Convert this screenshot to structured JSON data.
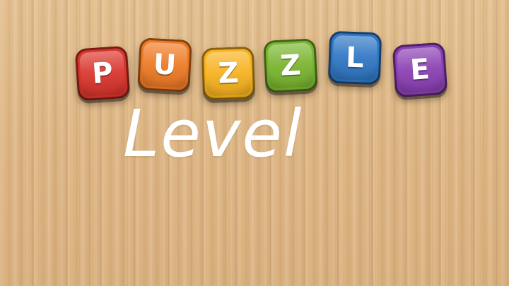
{
  "title": {
    "letters": [
      "P",
      "U",
      "Z",
      "Z",
      "L",
      "E"
    ],
    "tile_colors": [
      "#d9342b",
      "#ee7a24",
      "#f7b21e",
      "#79b52e",
      "#2f76c4",
      "#8b3fb3"
    ]
  },
  "subtitle": "Level"
}
